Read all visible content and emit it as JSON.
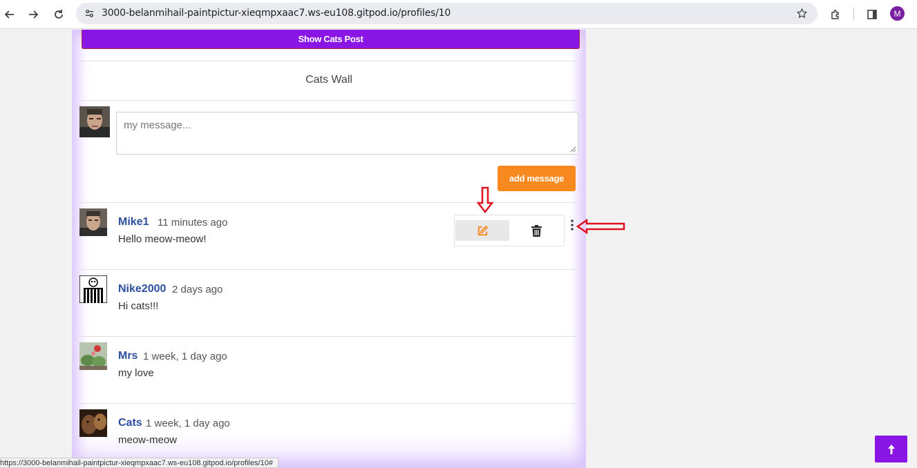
{
  "browser": {
    "url": "3000-belanmihail-paintpictur-xieqmpxaac7.ws-eu108.gitpod.io/profiles/10",
    "profile_initial": "M",
    "status_url": "https://3000-belanmihail-paintpictur-xieqmpxaac7.ws-eu108.gitpod.io/profiles/10#"
  },
  "page": {
    "show_cats_button": "Show Cats Post",
    "wall_title": "Cats Wall",
    "message_placeholder": "my message...",
    "add_message_button": "add message",
    "accent_color": "#8a16e6",
    "orange_color": "#f7891f"
  },
  "posts": [
    {
      "user": "Mike1",
      "time": "11 minutes ago",
      "text": "Hello meow-meow!"
    },
    {
      "user": "Nike2000",
      "time": "2 days ago",
      "text": "Hi cats!!!"
    },
    {
      "user": "Mrs",
      "time": "1 week, 1 day ago",
      "text": "my love"
    },
    {
      "user": "Cats",
      "time": "1 week, 1 day ago",
      "text": "meow-meow"
    }
  ]
}
